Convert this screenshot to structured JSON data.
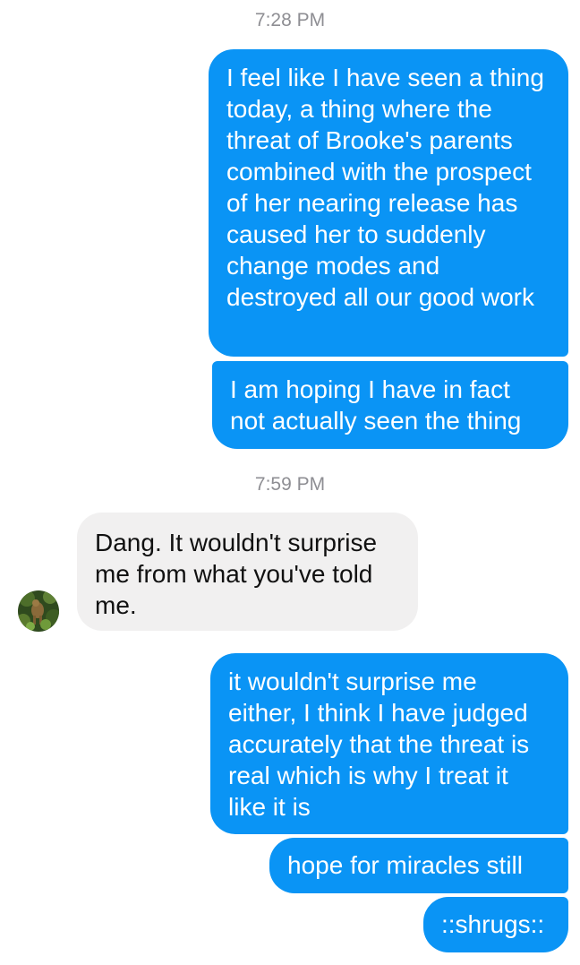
{
  "thread": {
    "timestamps": [
      "7:28 PM",
      "7:59 PM"
    ],
    "messages": [
      {
        "sender": "me",
        "text": "I feel like I have seen a thing today, a thing where the threat of Brooke's parents combined with the prospect of her nearing release has caused her to suddenly change modes and destroyed all our good work"
      },
      {
        "sender": "me",
        "text": "I am hoping I have in fact not actually seen the thing"
      },
      {
        "sender": "other",
        "text": "Dang. It wouldn't surprise me from what you've told me."
      },
      {
        "sender": "me",
        "text": "it wouldn't surprise me either, I think I have judged accurately that the threat is real which is why I treat it like it is"
      },
      {
        "sender": "me",
        "text": "hope for miracles still"
      },
      {
        "sender": "me",
        "text": "::shrugs::"
      }
    ]
  },
  "colors": {
    "sent_bubble": "#0a94f5",
    "received_bubble": "#f1f0f0",
    "timestamp_text": "#8e8e93"
  },
  "icons": {
    "contact_avatar": "avatar-photo-icon"
  }
}
